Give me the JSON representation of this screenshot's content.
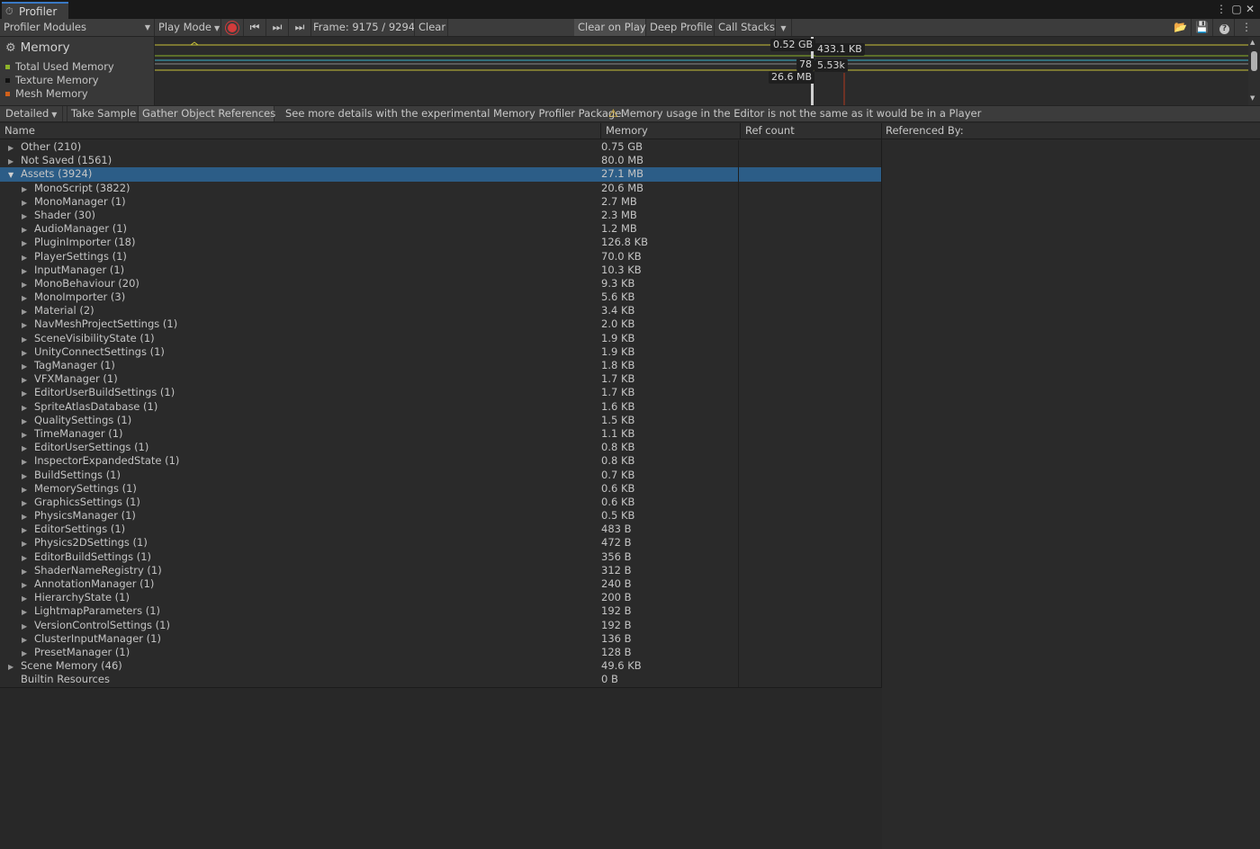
{
  "window": {
    "tab_title": "Profiler"
  },
  "toolbar": {
    "modules_label": "Profiler Modules",
    "play_mode_label": "Play Mode",
    "frame_text": "Frame: 9175 / 9294",
    "clear_label": "Clear",
    "clear_on_play_label": "Clear on Play",
    "deep_profile_label": "Deep Profile",
    "call_stacks_label": "Call Stacks"
  },
  "module": {
    "title": "Memory",
    "legend": [
      {
        "label": "Total Used Memory",
        "color": "#8db32a"
      },
      {
        "label": "Texture Memory",
        "color": "#111111"
      },
      {
        "label": "Mesh Memory",
        "color": "#d0601a"
      }
    ]
  },
  "chart": {
    "labels": [
      "0.52 GB",
      "433.1 KB",
      "78",
      "5.53k",
      "26.6 MB"
    ],
    "colors": {
      "yellow": "#c8c23a",
      "cyan": "#3ab0c8",
      "olive": "#8db32a",
      "cursor": "#d0d0d0",
      "marker": "#b0391f"
    }
  },
  "toolbar2": {
    "view_mode": "Detailed",
    "take_sample": "Take Sample",
    "gather_refs": "Gather Object References",
    "info": "See more details with the experimental Memory Profiler Package.",
    "warning": "Memory usage in the Editor is not the same as it would be in a Player"
  },
  "tree": {
    "columns": {
      "name": "Name",
      "memory": "Memory",
      "ref_count": "Ref count"
    },
    "rows": [
      {
        "name": "Other (210)",
        "memory": "0.75 GB",
        "depth": 0,
        "expanded": false
      },
      {
        "name": "Not Saved (1561)",
        "memory": "80.0 MB",
        "depth": 0,
        "expanded": false
      },
      {
        "name": "Assets (3924)",
        "memory": "27.1 MB",
        "depth": 0,
        "expanded": true,
        "selected": true
      },
      {
        "name": "MonoScript (3822)",
        "memory": "20.6 MB",
        "depth": 1,
        "expanded": false
      },
      {
        "name": "MonoManager (1)",
        "memory": "2.7 MB",
        "depth": 1,
        "expanded": false
      },
      {
        "name": "Shader (30)",
        "memory": "2.3 MB",
        "depth": 1,
        "expanded": false
      },
      {
        "name": "AudioManager (1)",
        "memory": "1.2 MB",
        "depth": 1,
        "expanded": false
      },
      {
        "name": "PluginImporter (18)",
        "memory": "126.8 KB",
        "depth": 1,
        "expanded": false
      },
      {
        "name": "PlayerSettings (1)",
        "memory": "70.0 KB",
        "depth": 1,
        "expanded": false
      },
      {
        "name": "InputManager (1)",
        "memory": "10.3 KB",
        "depth": 1,
        "expanded": false
      },
      {
        "name": "MonoBehaviour (20)",
        "memory": "9.3 KB",
        "depth": 1,
        "expanded": false
      },
      {
        "name": "MonoImporter (3)",
        "memory": "5.6 KB",
        "depth": 1,
        "expanded": false
      },
      {
        "name": "Material (2)",
        "memory": "3.4 KB",
        "depth": 1,
        "expanded": false
      },
      {
        "name": "NavMeshProjectSettings (1)",
        "memory": "2.0 KB",
        "depth": 1,
        "expanded": false
      },
      {
        "name": "SceneVisibilityState (1)",
        "memory": "1.9 KB",
        "depth": 1,
        "expanded": false
      },
      {
        "name": "UnityConnectSettings (1)",
        "memory": "1.9 KB",
        "depth": 1,
        "expanded": false
      },
      {
        "name": "TagManager (1)",
        "memory": "1.8 KB",
        "depth": 1,
        "expanded": false
      },
      {
        "name": "VFXManager (1)",
        "memory": "1.7 KB",
        "depth": 1,
        "expanded": false
      },
      {
        "name": "EditorUserBuildSettings (1)",
        "memory": "1.7 KB",
        "depth": 1,
        "expanded": false
      },
      {
        "name": "SpriteAtlasDatabase (1)",
        "memory": "1.6 KB",
        "depth": 1,
        "expanded": false
      },
      {
        "name": "QualitySettings (1)",
        "memory": "1.5 KB",
        "depth": 1,
        "expanded": false
      },
      {
        "name": "TimeManager (1)",
        "memory": "1.1 KB",
        "depth": 1,
        "expanded": false
      },
      {
        "name": "EditorUserSettings (1)",
        "memory": "0.8 KB",
        "depth": 1,
        "expanded": false
      },
      {
        "name": "InspectorExpandedState (1)",
        "memory": "0.8 KB",
        "depth": 1,
        "expanded": false
      },
      {
        "name": "BuildSettings (1)",
        "memory": "0.7 KB",
        "depth": 1,
        "expanded": false
      },
      {
        "name": "MemorySettings (1)",
        "memory": "0.6 KB",
        "depth": 1,
        "expanded": false
      },
      {
        "name": "GraphicsSettings (1)",
        "memory": "0.6 KB",
        "depth": 1,
        "expanded": false
      },
      {
        "name": "PhysicsManager (1)",
        "memory": "0.5 KB",
        "depth": 1,
        "expanded": false
      },
      {
        "name": "EditorSettings (1)",
        "memory": "483 B",
        "depth": 1,
        "expanded": false
      },
      {
        "name": "Physics2DSettings (1)",
        "memory": "472 B",
        "depth": 1,
        "expanded": false
      },
      {
        "name": "EditorBuildSettings (1)",
        "memory": "356 B",
        "depth": 1,
        "expanded": false
      },
      {
        "name": "ShaderNameRegistry (1)",
        "memory": "312 B",
        "depth": 1,
        "expanded": false
      },
      {
        "name": "AnnotationManager (1)",
        "memory": "240 B",
        "depth": 1,
        "expanded": false
      },
      {
        "name": "HierarchyState (1)",
        "memory": "200 B",
        "depth": 1,
        "expanded": false
      },
      {
        "name": "LightmapParameters (1)",
        "memory": "192 B",
        "depth": 1,
        "expanded": false
      },
      {
        "name": "VersionControlSettings (1)",
        "memory": "192 B",
        "depth": 1,
        "expanded": false
      },
      {
        "name": "ClusterInputManager (1)",
        "memory": "136 B",
        "depth": 1,
        "expanded": false
      },
      {
        "name": "PresetManager (1)",
        "memory": "128 B",
        "depth": 1,
        "expanded": false
      },
      {
        "name": "Scene Memory (46)",
        "memory": "49.6 KB",
        "depth": 0,
        "expanded": false
      },
      {
        "name": "Builtin Resources",
        "memory": "0 B",
        "depth": 0,
        "leaf": true
      }
    ]
  },
  "ref_panel": {
    "title": "Referenced By:"
  },
  "icons": {
    "tab": "profiler-icon",
    "record": "record-icon",
    "prev_frame": "step-back-icon",
    "next_frame": "step-forward-icon",
    "last_frame": "last-frame-icon",
    "load": "load-icon",
    "save": "save-icon",
    "help": "help-icon",
    "menu": "kebab-menu-icon",
    "warning": "warning-icon",
    "settings": "gear-icon"
  }
}
